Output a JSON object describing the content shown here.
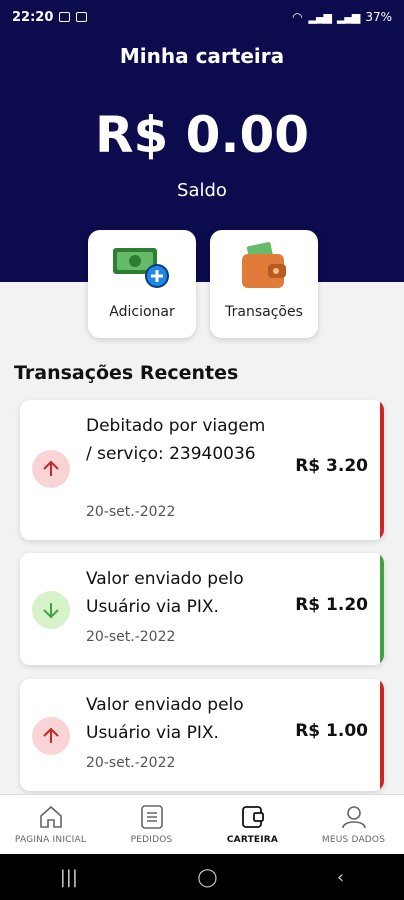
{
  "status_bar": {
    "time": "22:20",
    "battery": "37%"
  },
  "header": {
    "title": "Minha carteira",
    "balance": "R$ 0.00",
    "balance_label": "Saldo"
  },
  "actions": [
    {
      "label": "Adicionar",
      "icon": "money-add-icon"
    },
    {
      "label": "Transações",
      "icon": "wallet-icon"
    }
  ],
  "recent": {
    "title": "Transações Recentes",
    "items": [
      {
        "description": "Debitado por viagem / serviço: 23940036",
        "date": "20-set.-2022",
        "amount": "R$ 3.20",
        "direction": "debit",
        "icon": "arrow-up-icon"
      },
      {
        "description": "Valor enviado pelo Usuário via PIX.",
        "date": "20-set.-2022",
        "amount": "R$ 1.20",
        "direction": "credit",
        "icon": "arrow-down-icon"
      },
      {
        "description": "Valor enviado pelo Usuário via PIX.",
        "date": "20-set.-2022",
        "amount": "R$ 1.00",
        "direction": "debit",
        "icon": "arrow-up-icon"
      }
    ]
  },
  "bottom_nav": [
    {
      "label": "PAGINA INICIAL",
      "icon": "home-icon"
    },
    {
      "label": "PEDIDOS",
      "icon": "orders-icon"
    },
    {
      "label": "CARTEIRA",
      "icon": "wallet-icon",
      "active": true
    },
    {
      "label": "MEUS DADOS",
      "icon": "user-icon"
    }
  ],
  "colors": {
    "primary": "#0b0b4e",
    "debit": "#c62828",
    "credit": "#43a047",
    "debit_bg": "#f8d4d6",
    "credit_bg": "#d6f2c9"
  }
}
